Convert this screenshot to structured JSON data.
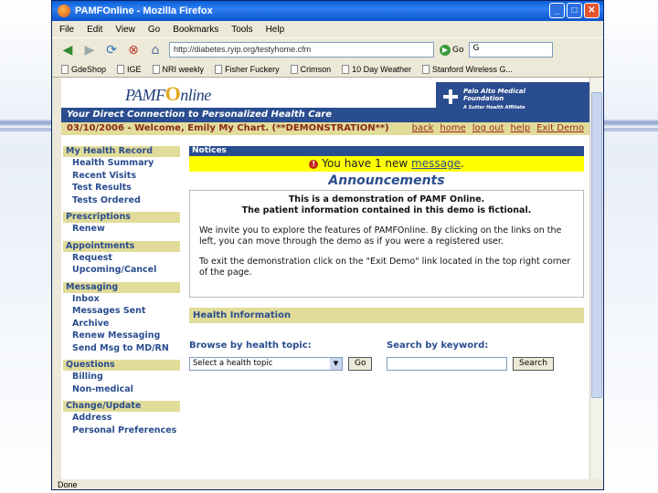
{
  "browser": {
    "title": "PAMFOnline - Mozilla Firefox",
    "menu": [
      "File",
      "Edit",
      "View",
      "Go",
      "Bookmarks",
      "Tools",
      "Help"
    ],
    "url": "http://diabetes.ryip.org/testyhome.cfm",
    "go_label": "Go",
    "bookmarks": [
      "GdeShop",
      "IGE",
      "NRI weekly",
      "Fisher Fuckery",
      "Crimson",
      "10 Day Weather",
      "Stanford Wireless G..."
    ],
    "status": "Done"
  },
  "site": {
    "logo_prefix": "PAMF",
    "logo_o": "O",
    "logo_suffix": "nline",
    "tagline": "Your Direct Connection to Personalized Health Care",
    "foundation_line1": "Palo Alto Medical",
    "foundation_line2": "Foundation",
    "foundation_line3": "A Sutter Health Affiliate",
    "welcome": "03/10/2006 - Welcome, Emily My Chart. (**DEMONSTRATION**)",
    "toplinks": [
      "back",
      "home",
      "log out",
      "help",
      "Exit Demo"
    ]
  },
  "sidebar": [
    {
      "title": "My Health Record",
      "items": [
        "Health Summary",
        "Recent Visits",
        "Test Results",
        "Tests Ordered"
      ]
    },
    {
      "title": "Prescriptions",
      "items": [
        "Renew"
      ]
    },
    {
      "title": "Appointments",
      "items": [
        "Request",
        "Upcoming/Cancel"
      ]
    },
    {
      "title": "Messaging",
      "items": [
        "Inbox",
        "Messages Sent",
        "Archive",
        "Renew Messaging",
        "Send Msg to MD/RN"
      ]
    },
    {
      "title": "Questions",
      "items": [
        "Billing",
        "Non-medical"
      ]
    },
    {
      "title": "Change/Update",
      "items": [
        "Address",
        "Personal Preferences"
      ]
    }
  ],
  "main": {
    "notices_title": "Notices",
    "notice_prefix": "You have 1 new ",
    "notice_link": "message",
    "notice_suffix": ".",
    "announcements_title": "Announcements",
    "ann_line1": "This is a demonstration of PAMF Online.",
    "ann_line2": "The patient information contained in this demo is fictional.",
    "ann_p1": "We invite you to explore the features of PAMFOnline. By clicking on the links on the left, you can move through the demo as if you were a registered user.",
    "ann_p2": "To exit the demonstration click on the \"Exit Demo\" link located in the top right corner of the page.",
    "health_title": "Health Information",
    "browse_label": "Browse by health topic:",
    "select_value": "Select a health topic",
    "go_button": "Go",
    "search_label": "Search by keyword:",
    "search_button": "Search"
  }
}
